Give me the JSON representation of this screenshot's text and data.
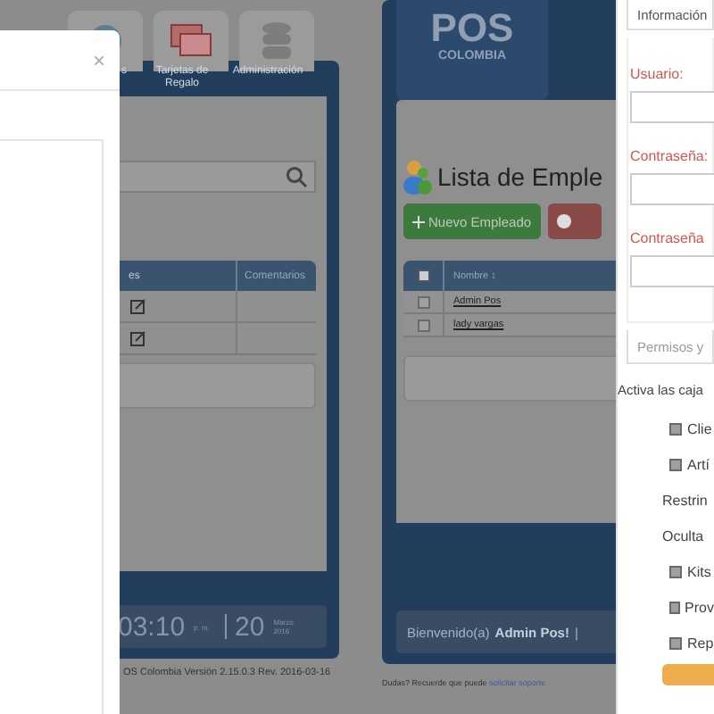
{
  "left_screen": {
    "toolbar": [
      {
        "label": "s"
      },
      {
        "label": "Tarjetas de Regalo"
      },
      {
        "label": "Administración"
      }
    ],
    "table": {
      "columns": [
        "es",
        "Comentarios"
      ]
    },
    "clock": {
      "time": "03:10",
      "ampm": "p. m.",
      "day": "20",
      "month": "Marzo 2016"
    },
    "footer": "OS Colombia Versión 2.15.0.3 Rev. 2016-03-16",
    "modal": {
      "close": "×"
    }
  },
  "middle_screen": {
    "logo": {
      "title": "POS",
      "subtitle": "COLOMBIA"
    },
    "heading": "Lista de Emple",
    "buttons": [
      {
        "kind": "add",
        "label": "Nuevo Empleado"
      },
      {
        "kind": "delete"
      }
    ],
    "table": {
      "columns": [
        "Nombre ↕"
      ],
      "select_all": {
        "checked": false
      },
      "rows": [
        {
          "name": "Admin Pos",
          "checked": false
        },
        {
          "name": "lady vargas",
          "checked": false
        }
      ]
    },
    "welcome": {
      "text": "Bienvenido(a)",
      "user": "Admin Pos!",
      "sep": "|"
    },
    "help": {
      "text": "Dudas? Recuerde que puede",
      "link": "solicitar soporte"
    }
  },
  "right_modal": {
    "tabs": [
      {
        "label": "Información",
        "selected": true
      }
    ],
    "fields": [
      {
        "label": "Usuario:"
      },
      {
        "label": "Contraseña:"
      },
      {
        "label": "Contraseña"
      }
    ],
    "permissions_tab": {
      "label": "Permisos y",
      "selected": false
    },
    "intro": "Activa las caja",
    "items": [
      {
        "kind": "check",
        "label": "Clie",
        "checked": false
      },
      {
        "kind": "check",
        "label": "Artí",
        "checked": false
      },
      {
        "kind": "text",
        "label": "Restrin"
      },
      {
        "kind": "text",
        "label": "Oculta"
      },
      {
        "kind": "check",
        "label": "Kits",
        "checked": false
      },
      {
        "kind": "check",
        "label": "Prov",
        "checked": false
      },
      {
        "kind": "check",
        "label": "Rep",
        "checked": false
      }
    ]
  }
}
